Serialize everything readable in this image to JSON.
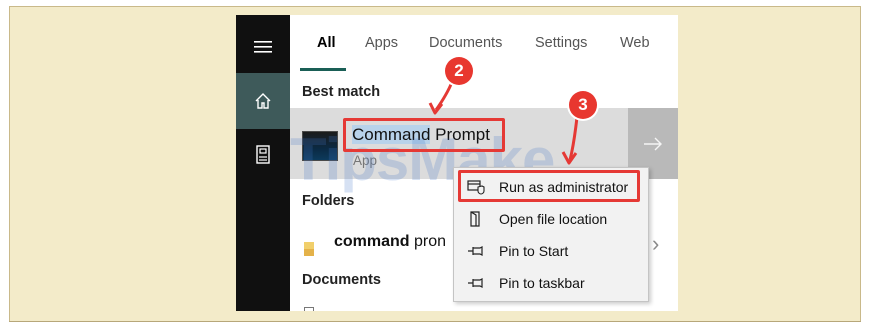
{
  "search": {
    "tabs": [
      {
        "label": "All"
      },
      {
        "label": "Apps"
      },
      {
        "label": "Documents"
      },
      {
        "label": "Settings"
      },
      {
        "label": "Web"
      }
    ],
    "best_match_heading": "Best match",
    "best_match": {
      "title_highlight": "Command",
      "title_rest": " Prompt",
      "type": "App"
    },
    "folders_heading": "Folders",
    "folder_item": {
      "bold": "command",
      "rest": " pron"
    },
    "documents_heading": "Documents"
  },
  "sidebar": {
    "items": [
      {
        "icon": "hamburger-menu-icon"
      },
      {
        "icon": "home-icon"
      },
      {
        "icon": "notebook-icon"
      }
    ]
  },
  "context_menu": {
    "items": [
      {
        "label": "Run as administrator",
        "icon": "run-as-admin-icon"
      },
      {
        "label": "Open file location",
        "icon": "folder-location-icon"
      },
      {
        "label": "Pin to Start",
        "icon": "pin-icon"
      },
      {
        "label": "Pin to taskbar",
        "icon": "pin-icon"
      }
    ]
  },
  "annotations": {
    "step_2": "2",
    "step_3": "3",
    "accent_color": "#e53935"
  },
  "watermark": "TipsMake",
  "colors": {
    "rail": "#101010",
    "rail_active": "#3e5a5a",
    "tab_underline": "#1a5f56",
    "selection": "#b8d2ea",
    "background_frame": "#f3ebc9"
  }
}
